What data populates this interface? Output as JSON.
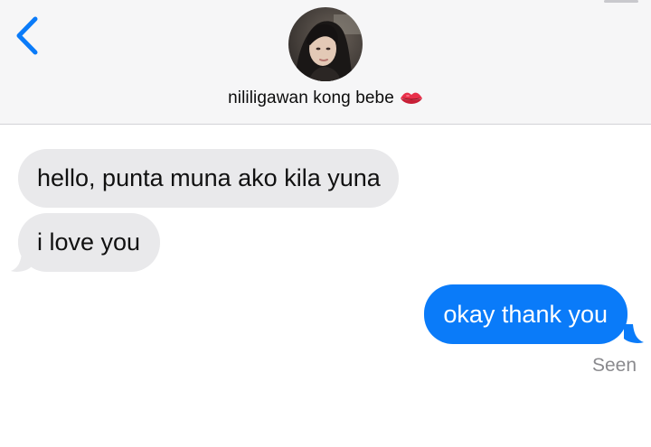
{
  "header": {
    "contact_name": "nililigawan kong bebe",
    "name_emoji": "lips-emoji-icon"
  },
  "messages": [
    {
      "direction": "received",
      "text": "hello, punta muna ako kila yuna"
    },
    {
      "direction": "received",
      "text": "i love you"
    },
    {
      "direction": "sent",
      "text": "okay thank you"
    }
  ],
  "status": {
    "seen_label": "Seen"
  },
  "colors": {
    "accent": "#0a7bf9",
    "received_bubble": "#e9e9eb",
    "header_bg": "#f6f6f7",
    "seen_text": "#8a8a8e"
  }
}
